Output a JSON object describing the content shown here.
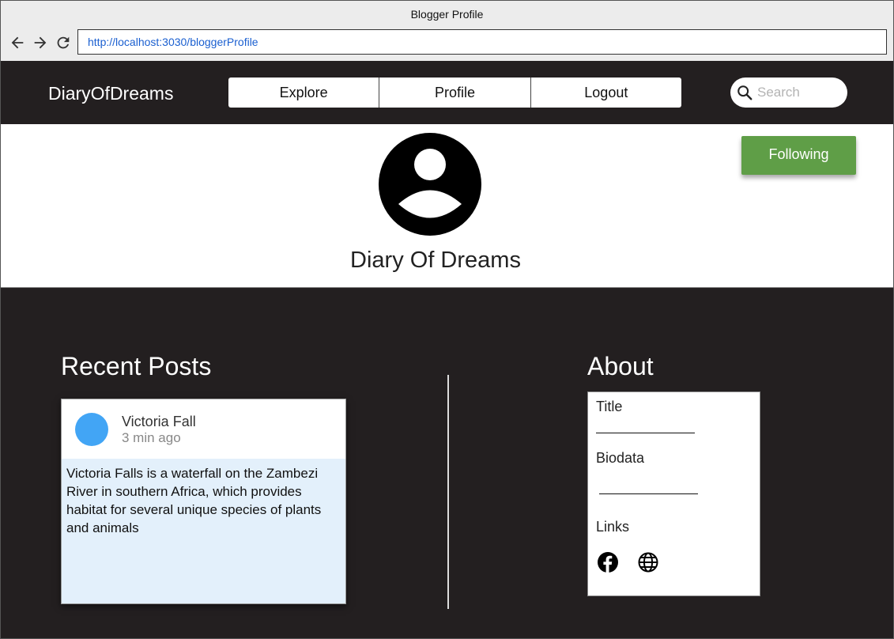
{
  "window": {
    "title": "Blogger Profile",
    "url": "http://localhost:3030/bloggerProfile"
  },
  "header": {
    "brand": "DiaryOfDreams",
    "nav": [
      {
        "label": "Explore"
      },
      {
        "label": "Profile"
      },
      {
        "label": "Logout"
      }
    ],
    "search": {
      "placeholder": "Search",
      "value": ""
    }
  },
  "profile": {
    "name": "Diary Of Dreams",
    "follow_label": "Following",
    "follow_color": "#5f9e47"
  },
  "recent_posts": {
    "title": "Recent Posts",
    "posts": [
      {
        "title": "Victoria Fall",
        "time": "3 min ago",
        "body": "Victoria Falls is a waterfall on the Zambezi River in southern Africa, which provides habitat for several unique species of plants and animals",
        "avatar_color": "#42a5f5"
      }
    ]
  },
  "about": {
    "title": "About",
    "fields": [
      {
        "label": "Title"
      },
      {
        "label": "Biodata"
      },
      {
        "label": "Links"
      }
    ],
    "links": [
      {
        "icon": "facebook-icon"
      },
      {
        "icon": "globe-icon"
      }
    ]
  }
}
